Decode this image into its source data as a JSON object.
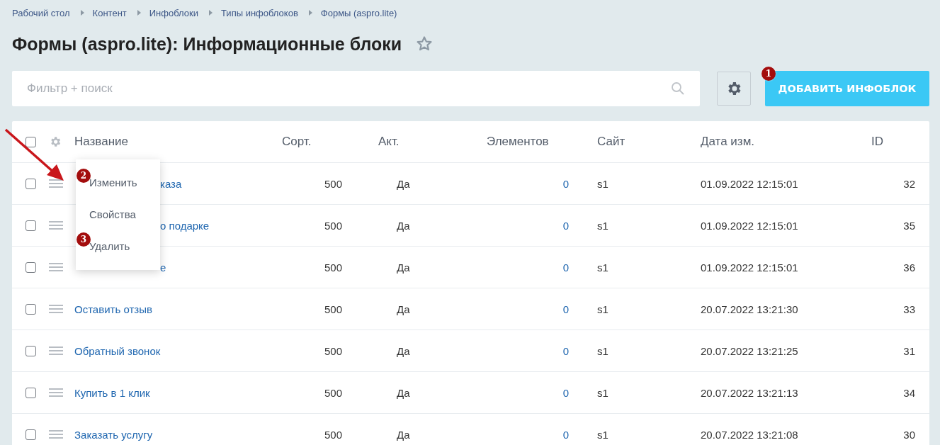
{
  "breadcrumbs": [
    "Рабочий стол",
    "Контент",
    "Инфоблоки",
    "Типы инфоблоков",
    "Формы (aspro.lite)"
  ],
  "title": "Формы (aspro.lite): Информационные блоки",
  "favorite": false,
  "filter": {
    "placeholder": "Фильтр + поиск"
  },
  "add_button": {
    "label": "ДОБАВИТЬ ИНФОБЛОК",
    "badge": "1"
  },
  "table": {
    "select_all_checked": false,
    "columns": [
      "Название",
      "Сорт.",
      "Акт.",
      "Элементов",
      "Сайт",
      "Дата изм.",
      "ID"
    ],
    "rows": [
      {
        "checked": false,
        "name": "каза",
        "sort": "500",
        "active": "Да",
        "elements": "0",
        "site": "s1",
        "date": "01.09.2022 12:15:01",
        "id": "32"
      },
      {
        "checked": false,
        "name": "о подарке",
        "sort": "500",
        "active": "Да",
        "elements": "0",
        "site": "s1",
        "date": "01.09.2022 12:15:01",
        "id": "35"
      },
      {
        "checked": false,
        "name": "е",
        "sort": "500",
        "active": "Да",
        "elements": "0",
        "site": "s1",
        "date": "01.09.2022 12:15:01",
        "id": "36"
      },
      {
        "checked": false,
        "name": "Оставить отзыв",
        "sort": "500",
        "active": "Да",
        "elements": "0",
        "site": "s1",
        "date": "20.07.2022 13:21:30",
        "id": "33"
      },
      {
        "checked": false,
        "name": "Обратный звонок",
        "sort": "500",
        "active": "Да",
        "elements": "0",
        "site": "s1",
        "date": "20.07.2022 13:21:25",
        "id": "31"
      },
      {
        "checked": false,
        "name": "Купить в 1 клик",
        "sort": "500",
        "active": "Да",
        "elements": "0",
        "site": "s1",
        "date": "20.07.2022 13:21:13",
        "id": "34"
      },
      {
        "checked": false,
        "name": "Заказать услугу",
        "sort": "500",
        "active": "Да",
        "elements": "0",
        "site": "s1",
        "date": "20.07.2022 13:21:08",
        "id": "30"
      }
    ]
  },
  "context_menu": {
    "items": [
      {
        "label": "Изменить",
        "badge": "2"
      },
      {
        "label": "Свойства"
      },
      {
        "label": "Удалить",
        "badge": "3"
      }
    ]
  }
}
